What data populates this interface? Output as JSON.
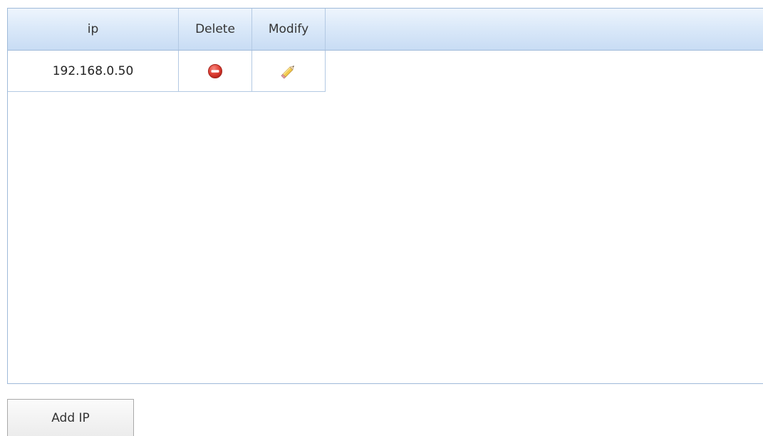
{
  "grid": {
    "columns": {
      "ip": "ip",
      "delete": "Delete",
      "modify": "Modify"
    },
    "rows": [
      {
        "ip": "192.168.0.50",
        "delete_icon": "delete-minus-icon",
        "modify_icon": "pencil-icon"
      }
    ]
  },
  "actions": {
    "add_ip_label": "Add IP"
  },
  "colors": {
    "header_gradient_top": "#eef5fd",
    "header_gradient_bottom": "#c8dcf4",
    "border": "#9fbad9",
    "delete_red": "#d9342b"
  }
}
